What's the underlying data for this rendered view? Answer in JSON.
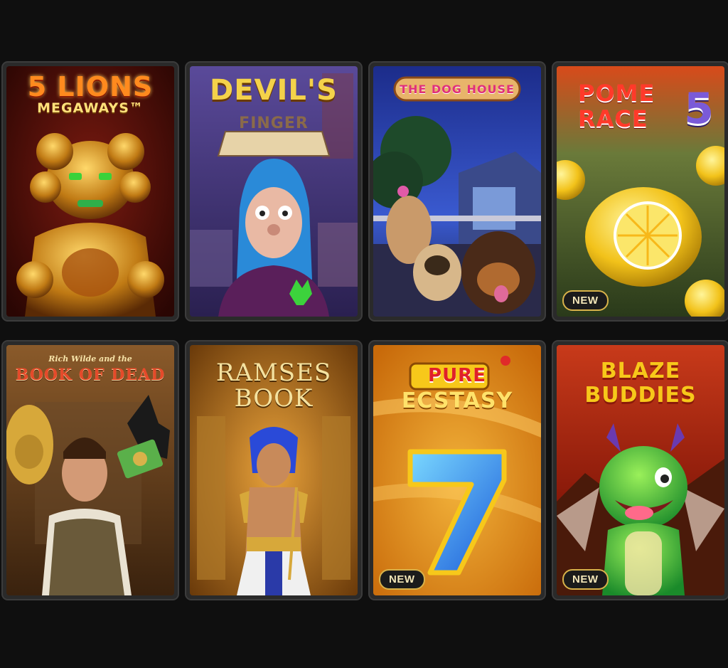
{
  "games": [
    {
      "title_line1": "5 LIONS",
      "title_line2": "MEGAWAYS™",
      "badge": ""
    },
    {
      "title_line1": "DEVIL'S",
      "title_line2": "FINGER",
      "badge": ""
    },
    {
      "title_line1": "THE DOG HOUSE",
      "title_line2": "",
      "badge": ""
    },
    {
      "title_line1": "POME",
      "title_line2": "RACE",
      "title_number": "5",
      "badge": "NEW"
    },
    {
      "title_line0": "Rich Wilde and the",
      "title_line1": "BOOK OF DEAD",
      "badge": ""
    },
    {
      "title_line1": "RAMSES",
      "title_line2": "BOOK",
      "badge": ""
    },
    {
      "title_line1": "PURE",
      "title_line2": "ECSTASY",
      "badge": "NEW"
    },
    {
      "title_line1": "BLAZE",
      "title_line2": "BUDDIES",
      "badge": "NEW"
    }
  ],
  "colors": {
    "page_background": "#0f0f0f",
    "tile_frame": "#2a2a2a",
    "badge_border": "#d8b24a",
    "badge_text": "#f3e6b8"
  }
}
